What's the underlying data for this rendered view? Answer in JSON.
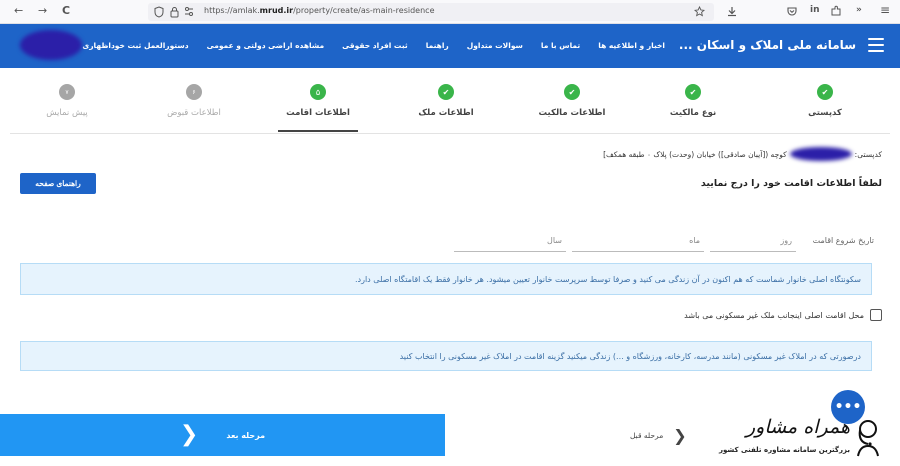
{
  "browser": {
    "url_prefix": "https://amlak.",
    "url_domain": "mrud.ir",
    "url_path": "/property/create/as-main-residence",
    "nav_back": "←",
    "nav_forward": "→",
    "nav_reload": "C",
    "menu_icon": "≡",
    "ext_in": "in",
    "more": "»"
  },
  "header": {
    "title": "سامانه ملی املاک و اسکان ...",
    "menu": [
      "اخبار و اطلاعیه ها",
      "تماس با ما",
      "سوالات متداول",
      "راهنما",
      "ثبت افراد حقوقی",
      "مشاهده اراضی دولتی و عمومی",
      "دستورالعمل ثبت خوداظهاری"
    ]
  },
  "stepper": {
    "steps": [
      {
        "label": "کدپستی",
        "status": "done"
      },
      {
        "label": "نوع مالکیت",
        "status": "done"
      },
      {
        "label": "اطلاعات مالکیت",
        "status": "done"
      },
      {
        "label": "اطلاعات ملک",
        "status": "done"
      },
      {
        "label": "اطلاعات اقامت",
        "status": "current",
        "number": "۵"
      },
      {
        "label": "اطلاعات قبوض",
        "status": "todo",
        "number": "۶"
      },
      {
        "label": "پیش نمایش",
        "status": "todo",
        "number": "۷"
      }
    ]
  },
  "address": {
    "prefix": "کدپستی:",
    "text": "کوچه ([آیبان صادقی]) خیابان (وحدت) پلاک ۰ طبقه همکف]"
  },
  "guide_button": "راهنمای صفحه",
  "prompt": "لطفاً اطلاعات اقامت خود را درج نمایید",
  "residence_start": {
    "label": "تاریخ شروع اقامت",
    "day_placeholder": "روز",
    "month_placeholder": "ماه",
    "year_placeholder": "سال"
  },
  "info_main": "سکونتگاه اصلی خانوار شماست که هم اکنون در آن زندگی می کنید و صرفا توسط سرپرست خانوار تعیین میشود. هر خانوار فقط یک اقامتگاه اصلی دارد.",
  "non_residential_checkbox": "محل اقامت اصلی اینجانب ملک غیر مسکونی می باشد",
  "info_non_residential": "درصورتی که در املاک غیر مسکونی (مانند مدرسه، کارخانه، ورزشگاه و ...) زندگی میکنید گزینه اقامت در املاک غیر مسکونی را انتخاب کنید",
  "nav": {
    "next_label": "مرحله بعد",
    "prev_label": "مرحله قبل",
    "next_chevron": "❮",
    "prev_chevron": "❮"
  },
  "watermark": {
    "title": "همراه مشاور",
    "subtitle": "بزرگترین سامانه مشاوره تلفنی کشور"
  },
  "chat_icon": "•••",
  "colors": {
    "primary": "#1e64c8",
    "next_button": "#2196f3",
    "success": "#3ab54a",
    "info_bg": "#e6f3fd"
  }
}
